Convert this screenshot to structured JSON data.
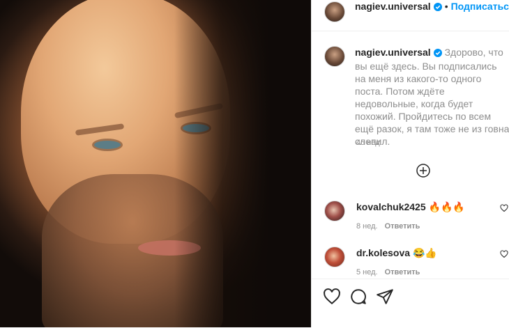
{
  "header": {
    "username": "nagiev.universal",
    "separator": "•",
    "follow_label": "Подписаться"
  },
  "caption": {
    "username": "nagiev.universal",
    "text": "Здорово, что вы ещё здесь. Вы подписались на меня из какого-то одного поста. Потом ждёте недовольные, когда будет похожий. Пройдитесь по всем ещё разок, я там тоже не из говна слепил.",
    "time_ago": "45 нед."
  },
  "comments": [
    {
      "username": "kovalchuk2425",
      "text": "🔥🔥🔥",
      "time_ago": "8 нед.",
      "reply_label": "Ответить"
    },
    {
      "username": "dr.kolesova",
      "text": "😂👍",
      "time_ago": "5 нед.",
      "reply_label": "Ответить"
    }
  ],
  "icons": {
    "verified": "verified-badge-icon",
    "load_more": "plus-circle-icon",
    "like": "heart-icon",
    "comment": "comment-icon",
    "share": "paper-plane-icon"
  },
  "colors": {
    "accent": "#0095f6",
    "secondary_text": "#8e8e8e",
    "primary_text": "#262626"
  }
}
